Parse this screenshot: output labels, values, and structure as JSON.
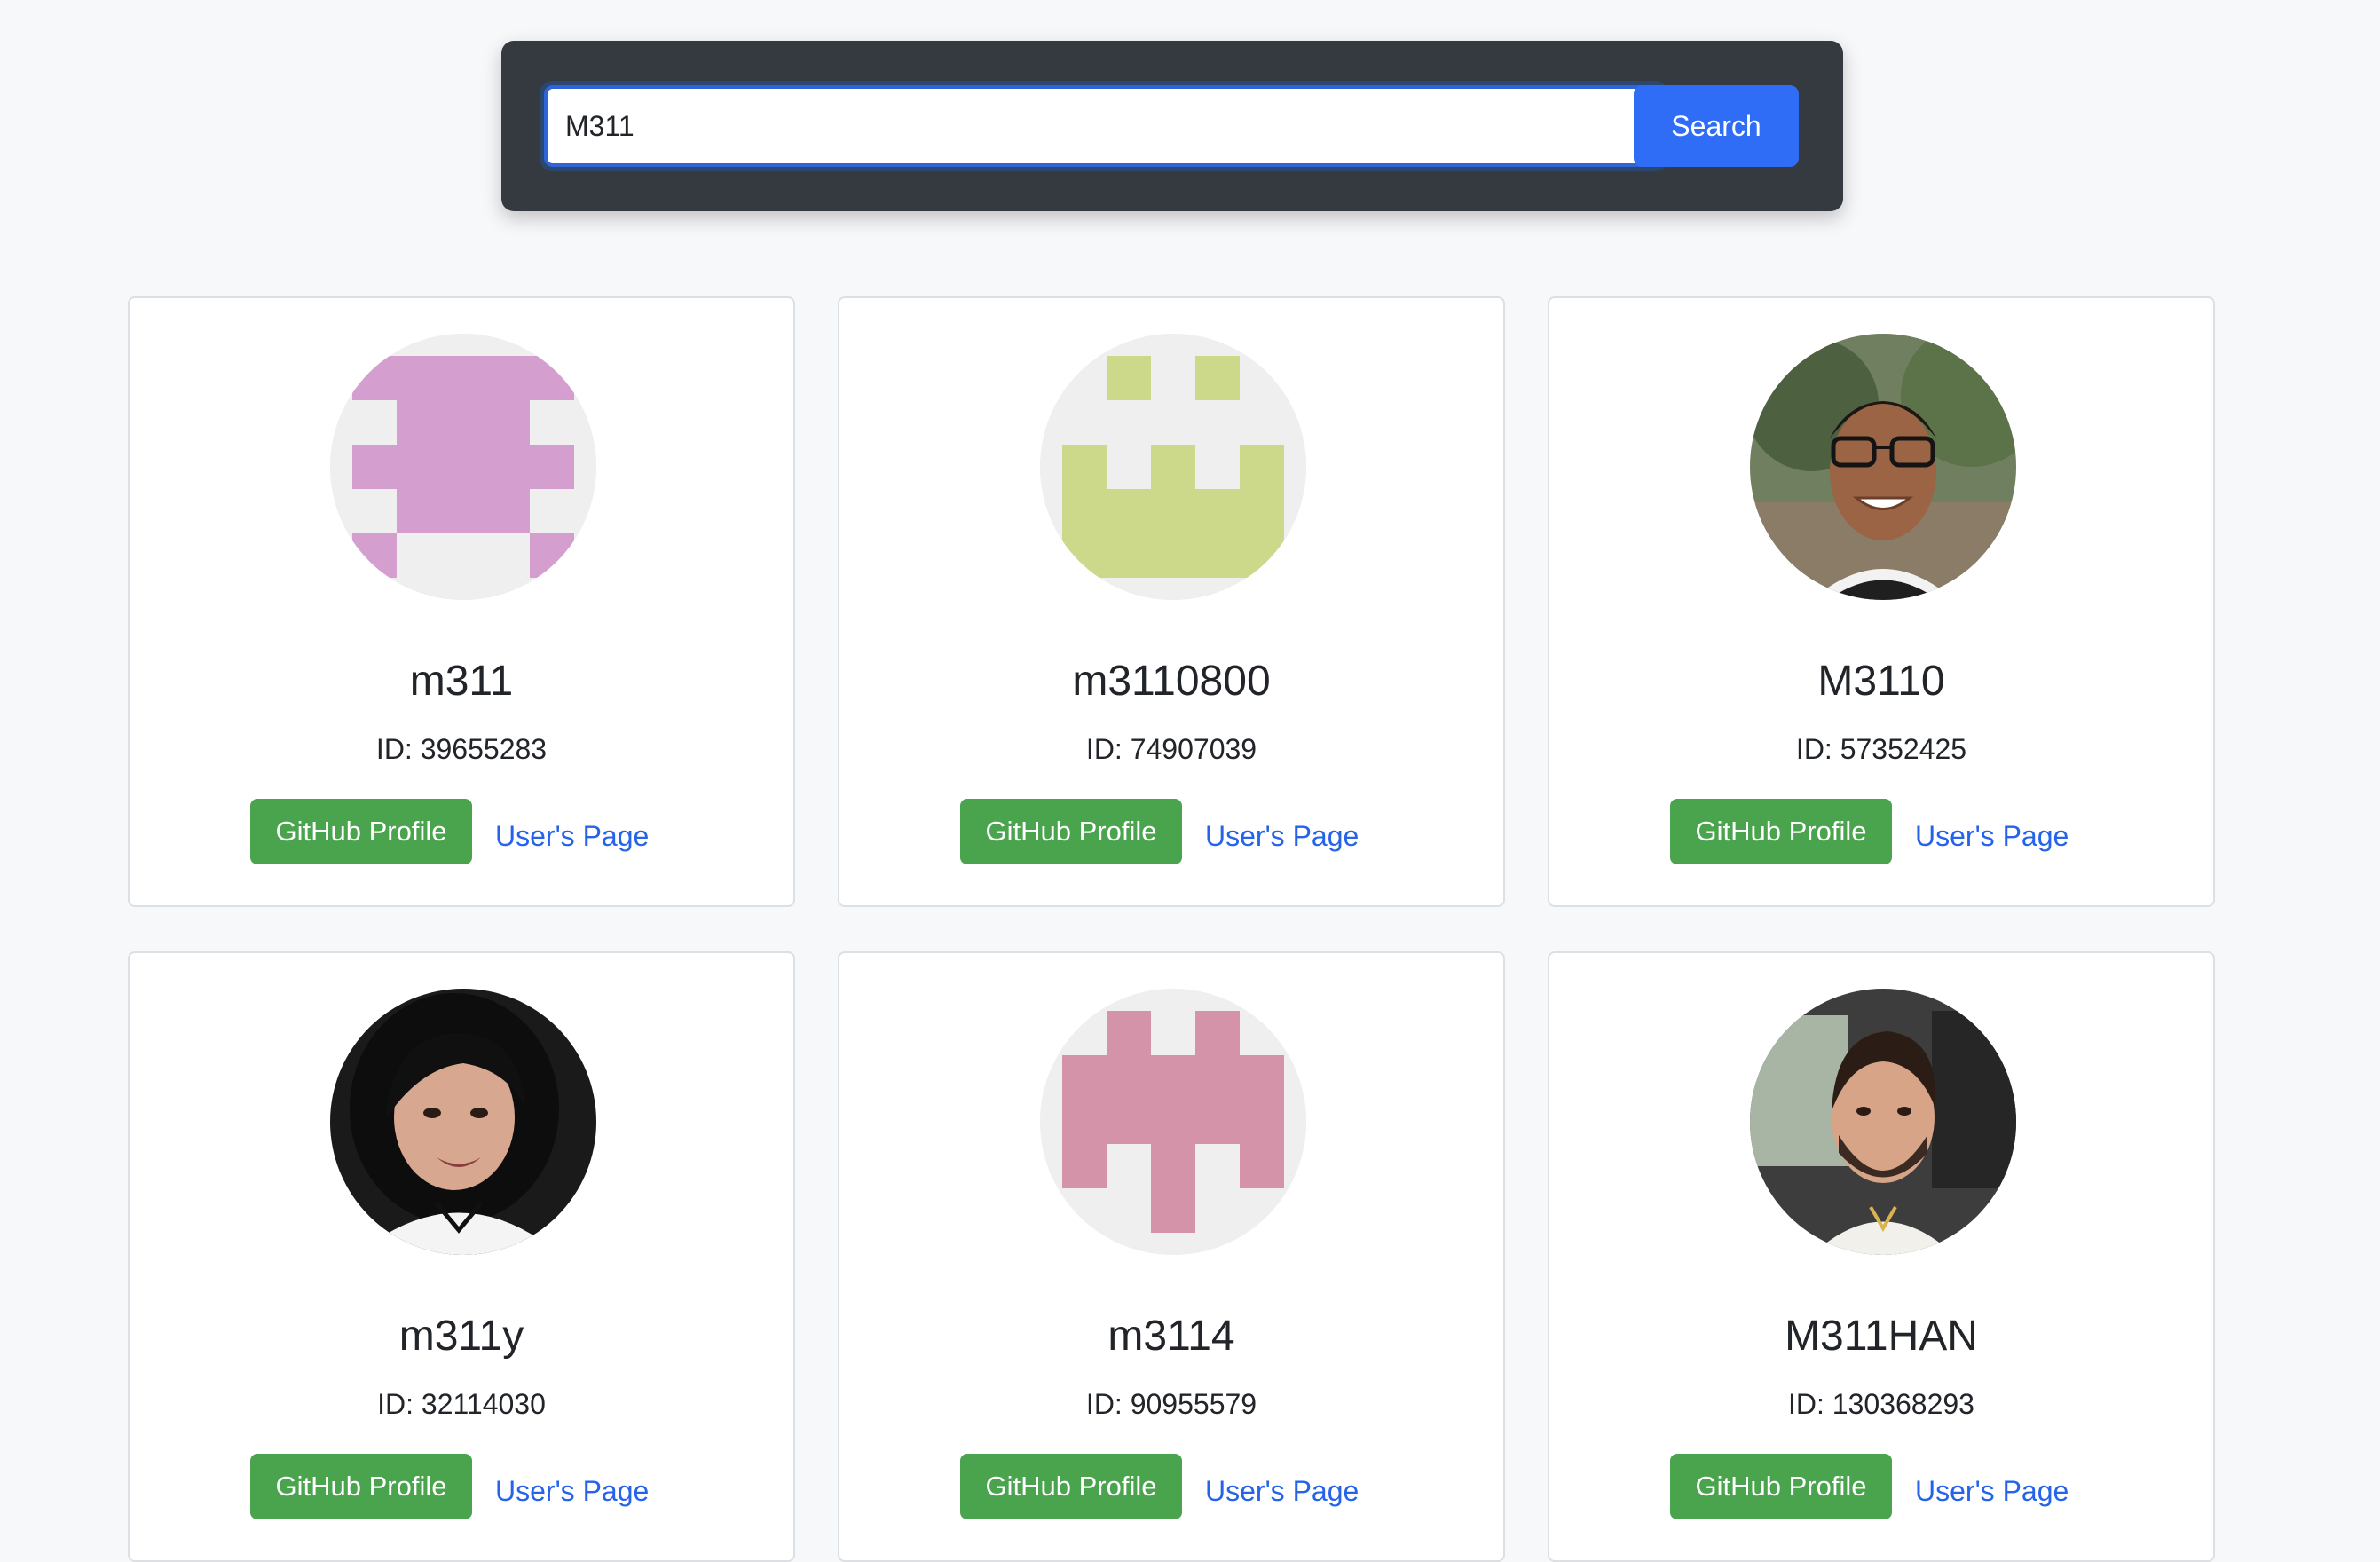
{
  "search": {
    "value": "M311",
    "button_label": "Search"
  },
  "results": [
    {
      "username": "m311",
      "id_text": "ID: 39655283",
      "github_label": "GitHub Profile",
      "page_label": "User's Page",
      "avatar": "identicon",
      "avatar_color": "#d49ecf"
    },
    {
      "username": "m3110800",
      "id_text": "ID: 74907039",
      "github_label": "GitHub Profile",
      "page_label": "User's Page",
      "avatar": "identicon",
      "avatar_color": "#cdd98a"
    },
    {
      "username": "M3110",
      "id_text": "ID: 57352425",
      "github_label": "GitHub Profile",
      "page_label": "User's Page",
      "avatar": "photo"
    },
    {
      "username": "m311y",
      "id_text": "ID: 32114030",
      "github_label": "GitHub Profile",
      "page_label": "User's Page",
      "avatar": "photo"
    },
    {
      "username": "m3114",
      "id_text": "ID: 90955579",
      "github_label": "GitHub Profile",
      "page_label": "User's Page",
      "avatar": "identicon",
      "avatar_color": "#d493a9"
    },
    {
      "username": "M311HAN",
      "id_text": "ID: 130368293",
      "github_label": "GitHub Profile",
      "page_label": "User's Page",
      "avatar": "photo"
    }
  ],
  "colors": {
    "panel": "#343a40",
    "primary": "#2f6df6",
    "success": "#4aa34d",
    "link": "#2563eb",
    "background": "#f7f8fa"
  }
}
